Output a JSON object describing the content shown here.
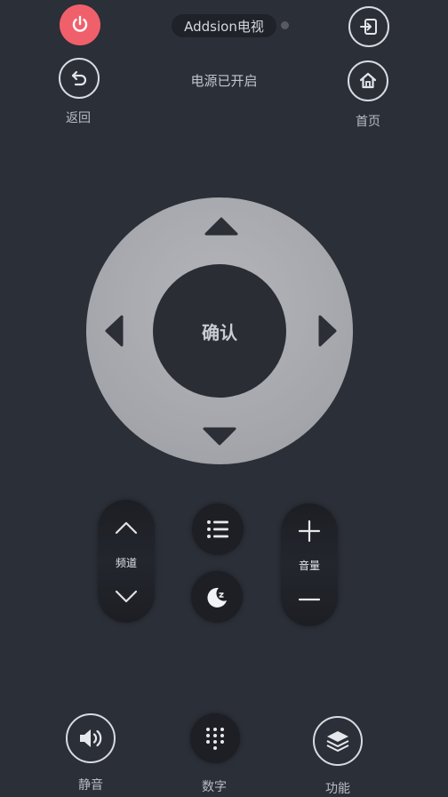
{
  "header": {
    "device_name": "Addsion电视",
    "status": "电源已开启",
    "connection_dot_color": "#555a63"
  },
  "top_left": {
    "back_label": "返回"
  },
  "top_right": {
    "home_label": "首页"
  },
  "dpad": {
    "ok_label": "确认"
  },
  "channel": {
    "label": "频道"
  },
  "volume": {
    "label": "音量"
  },
  "bottom": {
    "mute_label": "静音",
    "number_label": "数字",
    "function_label": "功能"
  },
  "colors": {
    "background": "#2b2f38",
    "power": "#f0606a",
    "dpad_outer": "#a6a8ad",
    "dpad_inner": "#2a2d34"
  }
}
